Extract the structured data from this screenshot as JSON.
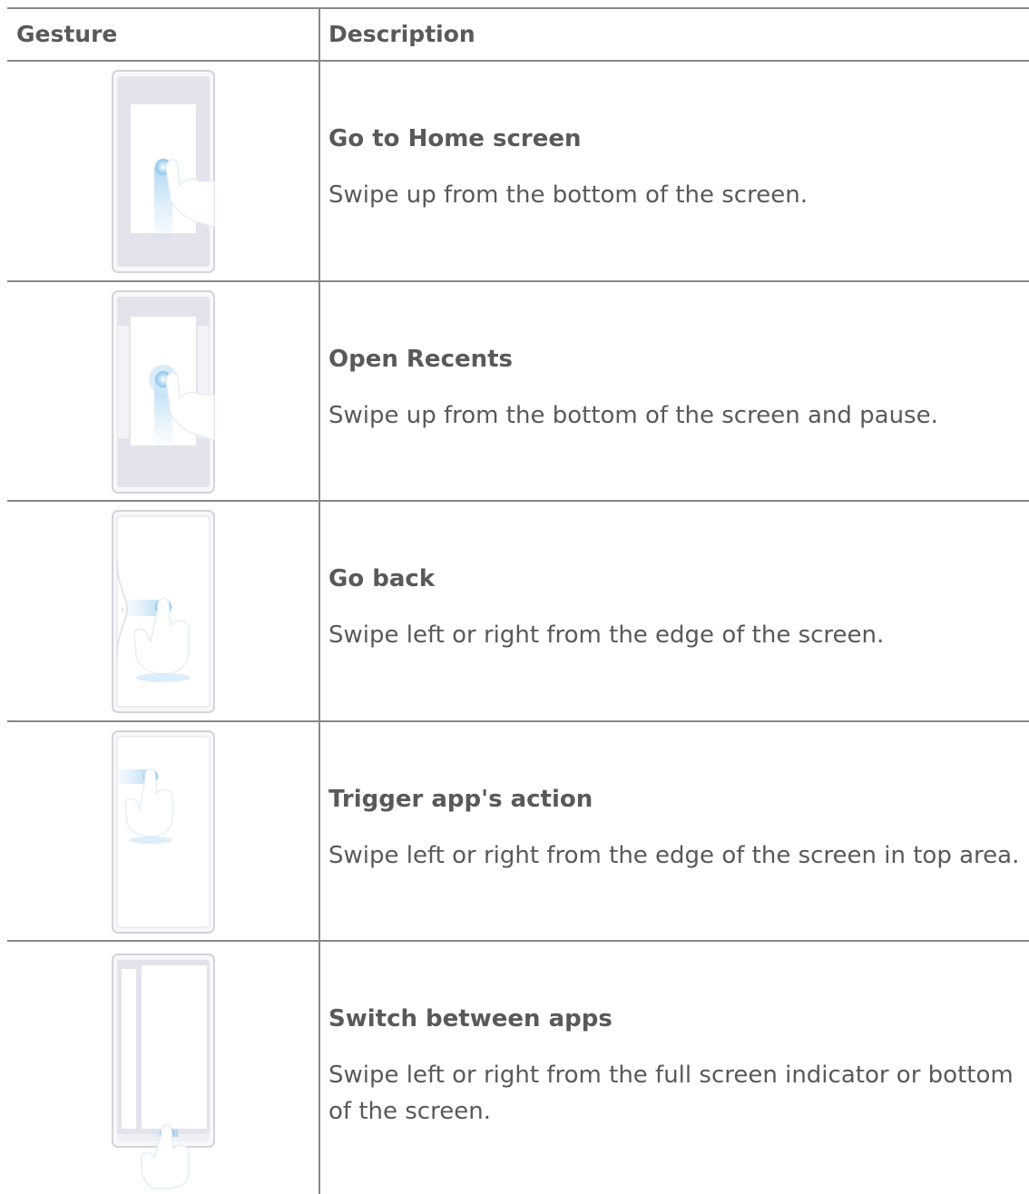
{
  "table": {
    "headers": {
      "gesture": "Gesture",
      "description": "Description"
    },
    "rows": [
      {
        "title": "Go to Home screen",
        "text": "Swipe up from the bottom of the screen.",
        "illustration": "swipe-up-home-icon"
      },
      {
        "title": "Open Recents",
        "text": "Swipe up from the bottom of the screen and pause.",
        "illustration": "swipe-up-pause-recents-icon"
      },
      {
        "title": "Go back",
        "text": "Swipe left or right from the edge of the screen.",
        "illustration": "swipe-edge-back-icon"
      },
      {
        "title": "Trigger app's action",
        "text": "Swipe left or right from the edge of the screen in top area.",
        "illustration": "swipe-edge-top-action-icon"
      },
      {
        "title": "Switch between apps",
        "text": "Swipe left or right from the full screen indicator or bottom of the screen.",
        "illustration": "swipe-bottom-switch-apps-icon"
      }
    ]
  },
  "colors": {
    "text": "#595959",
    "rule": "#888888",
    "phone_frame": "#d3d3d8",
    "screen_fill": "#e4e3ec",
    "touch_accent": "#a9d4f2"
  }
}
